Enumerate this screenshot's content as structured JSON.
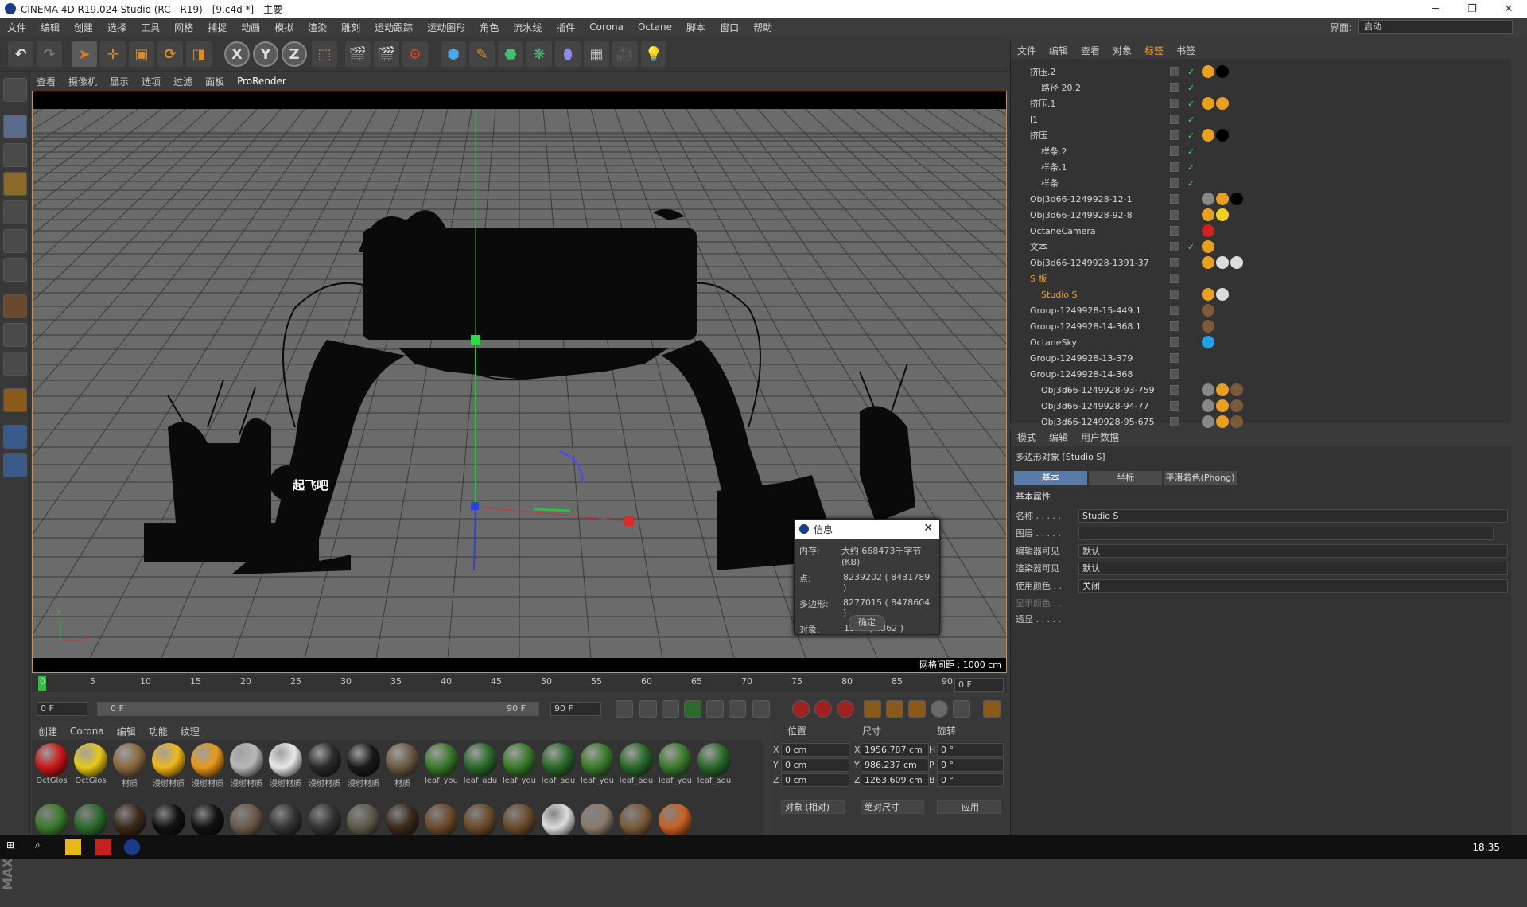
{
  "window": {
    "title": "CINEMA 4D R19.024 Studio (RC - R19) - [9.c4d *] - 主要"
  },
  "menubar": {
    "items": [
      "文件",
      "编辑",
      "创建",
      "选择",
      "工具",
      "网格",
      "捕捉",
      "动画",
      "模拟",
      "渲染",
      "雕刻",
      "运动跟踪",
      "运动图形",
      "角色",
      "流水线",
      "插件",
      "Corona",
      "Octane",
      "脚本",
      "窗口",
      "帮助"
    ],
    "layout_label": "界面:",
    "layout_value": "启动"
  },
  "viewport": {
    "menu": [
      "查看",
      "摄像机",
      "显示",
      "选项",
      "过滤",
      "面板",
      "ProRender"
    ],
    "grid_info": "网格间距 : 1000 cm"
  },
  "info_dialog": {
    "title": "信息",
    "rows": [
      {
        "k": "内存:",
        "v": "大约 668473千字节(KB)"
      },
      {
        "k": "点:",
        "v": "8239202 ( 8431789 )"
      },
      {
        "k": "多边形:",
        "v": "8277015 ( 8478604 )"
      },
      {
        "k": "对象:",
        "v": "1354 ( 2362 )"
      }
    ],
    "ok": "确定"
  },
  "timeline": {
    "ticks": [
      "0",
      "5",
      "10",
      "15",
      "20",
      "25",
      "30",
      "35",
      "40",
      "45",
      "50",
      "55",
      "60",
      "65",
      "70",
      "75",
      "80",
      "85",
      "90"
    ],
    "current_frame": "0 F"
  },
  "playbar": {
    "start": "0 F",
    "range_start": "0 F",
    "range_end": "90 F",
    "end": "90 F"
  },
  "materials": {
    "menu": [
      "创建",
      "Corona",
      "编辑",
      "功能",
      "纹理"
    ],
    "row1": [
      {
        "label": "OctGlos",
        "color": "#c81818"
      },
      {
        "label": "OctGlos",
        "color": "#e8c818"
      },
      {
        "label": "材质",
        "color": "#8a6a40"
      },
      {
        "label": "漫射材质",
        "color": "#f0b818"
      },
      {
        "label": "漫射材质",
        "color": "#e89818"
      },
      {
        "label": "漫射材质",
        "color": "#b8b8b8"
      },
      {
        "label": "漫射材质",
        "color": "#e8e8e8"
      },
      {
        "label": "漫射材质",
        "color": "#2a2a2a"
      },
      {
        "label": "漫射材质",
        "color": "#1a1a1a"
      },
      {
        "label": "材质",
        "color": "#6a5a40"
      },
      {
        "label": "leaf_you",
        "color": "#3a7a2a"
      },
      {
        "label": "leaf_adu",
        "color": "#2a6a2a"
      },
      {
        "label": "leaf_you",
        "color": "#3a7a2a"
      },
      {
        "label": "leaf_adu",
        "color": "#2a6a2a"
      },
      {
        "label": "leaf_you",
        "color": "#3a7a2a"
      },
      {
        "label": "leaf_adu",
        "color": "#2a6a2a"
      },
      {
        "label": "leaf_you",
        "color": "#3a7a2a"
      },
      {
        "label": "leaf_adu",
        "color": "#2a6a2a"
      }
    ]
  },
  "coords": {
    "headers": [
      "位置",
      "尺寸",
      "旋转"
    ],
    "rows": [
      {
        "axis": "X",
        "pos": "0 cm",
        "saxis": "X",
        "size": "1956.787 cm",
        "raxis": "H",
        "rot": "0 °"
      },
      {
        "axis": "Y",
        "pos": "0 cm",
        "saxis": "Y",
        "size": "986.237 cm",
        "raxis": "P",
        "rot": "0 °"
      },
      {
        "axis": "Z",
        "pos": "0 cm",
        "saxis": "Z",
        "size": "1263.609 cm",
        "raxis": "B",
        "rot": "0 °"
      }
    ],
    "mode": "对象 (相对)",
    "size_mode": "绝对尺寸",
    "apply": "应用"
  },
  "object_manager": {
    "menu": [
      "文件",
      "编辑",
      "查看",
      "对象",
      "标签",
      "书签"
    ],
    "items": [
      {
        "name": "挤压.2",
        "indent": 1
      },
      {
        "name": "路径 20.2",
        "indent": 2
      },
      {
        "name": "挤压.1",
        "indent": 1
      },
      {
        "name": "l1",
        "indent": 1
      },
      {
        "name": "挤压",
        "indent": 1
      },
      {
        "name": "样条.2",
        "indent": 2
      },
      {
        "name": "样条.1",
        "indent": 2
      },
      {
        "name": "样条",
        "indent": 2
      },
      {
        "name": "Obj3d66-1249928-12-1",
        "indent": 1
      },
      {
        "name": "Obj3d66-1249928-92-8",
        "indent": 1
      },
      {
        "name": "OctaneCamera",
        "indent": 1
      },
      {
        "name": "文本",
        "indent": 1
      },
      {
        "name": "Obj3d66-1249928-1391-37",
        "indent": 1
      },
      {
        "name": "S 板",
        "indent": 1
      },
      {
        "name": "Studio S",
        "indent": 2
      },
      {
        "name": "Group-1249928-15-449.1",
        "indent": 1
      },
      {
        "name": "Group-1249928-14-368.1",
        "indent": 1
      },
      {
        "name": "OctaneSky",
        "indent": 1
      },
      {
        "name": "Group-1249928-13-379",
        "indent": 1
      },
      {
        "name": "Group-1249928-14-368",
        "indent": 1
      },
      {
        "name": "Obj3d66-1249928-93-759",
        "indent": 2
      },
      {
        "name": "Obj3d66-1249928-94-77",
        "indent": 2
      },
      {
        "name": "Obj3d66-1249928-95-675",
        "indent": 2
      }
    ]
  },
  "attributes": {
    "menu": [
      "模式",
      "编辑",
      "用户数据"
    ],
    "title": "多边形对象 [Studio S]",
    "tabs": [
      "基本",
      "坐标",
      "平滑着色(Phong)"
    ],
    "section": "基本属性",
    "name_label": "名称 . . . . .",
    "name_value": "Studio S",
    "layer_label": "图层 . . . . .",
    "rows": [
      {
        "label": "编辑器可见",
        "value": "默认"
      },
      {
        "label": "渲染器可见",
        "value": "默认"
      },
      {
        "label": "使用颜色 . .",
        "value": "关闭"
      }
    ],
    "display_color": "显示颜色 . .",
    "xray": "透显 . . . . ."
  },
  "taskbar": {
    "time": "18:35"
  }
}
